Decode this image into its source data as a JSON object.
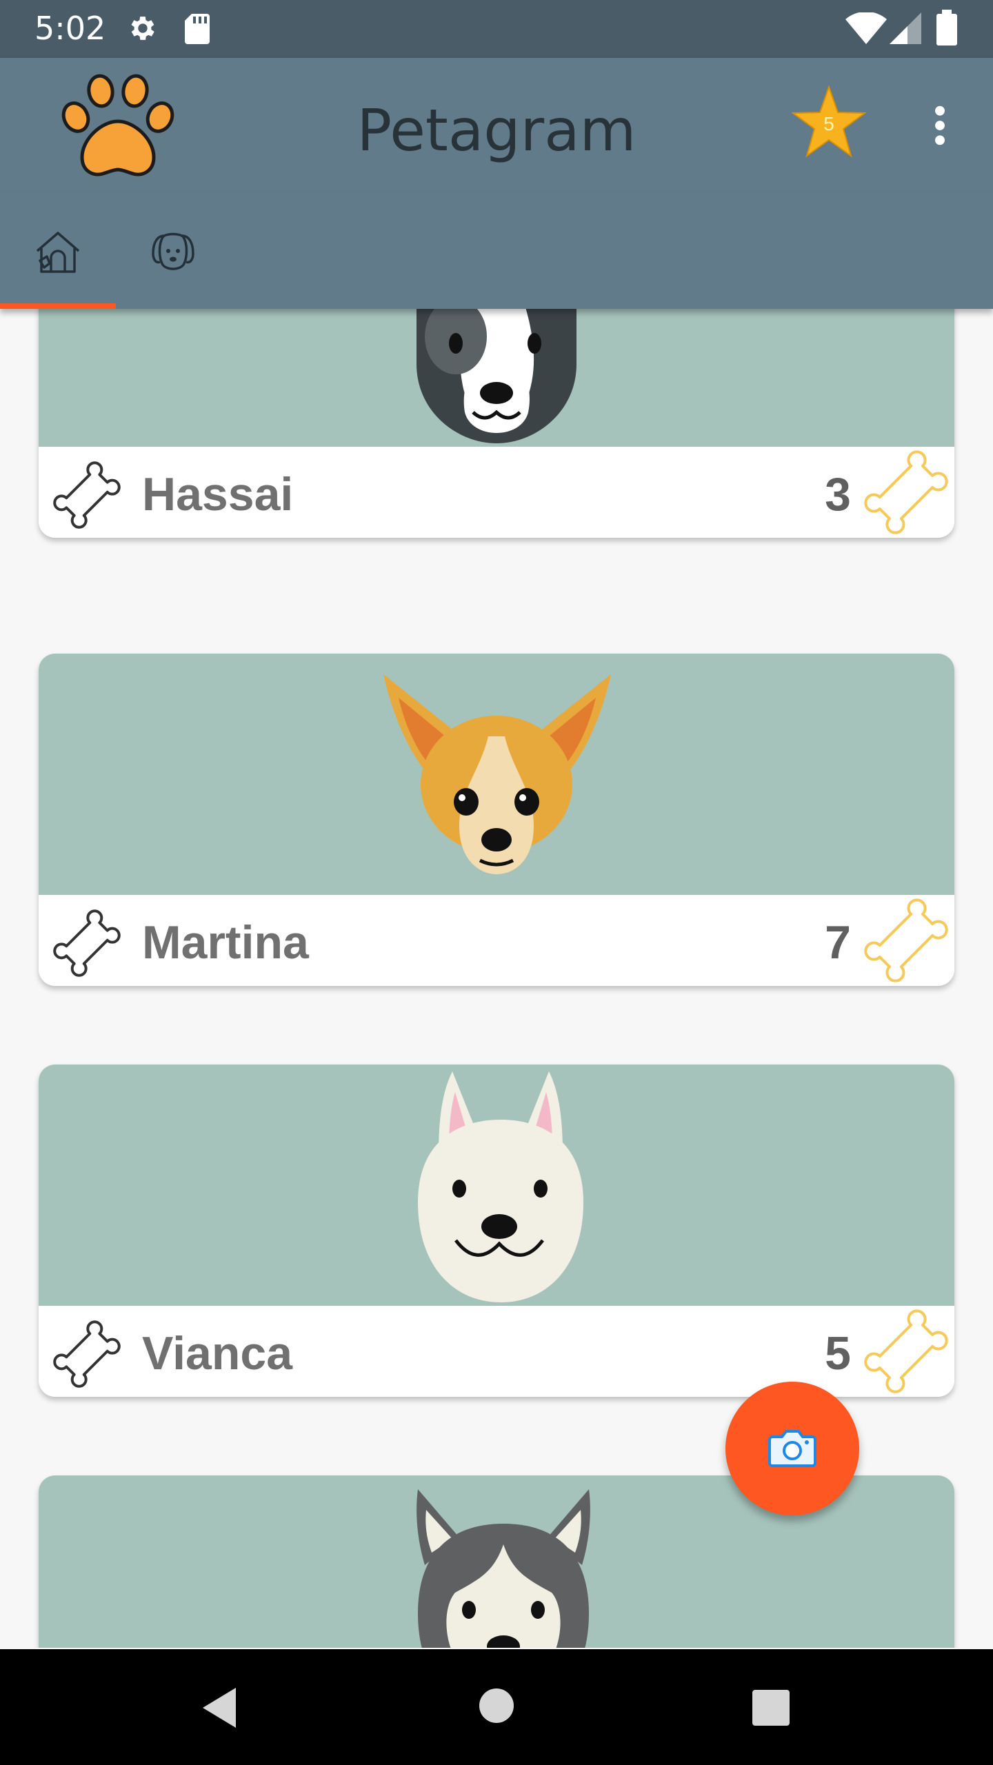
{
  "status_bar": {
    "time": "5:02"
  },
  "app_bar": {
    "title": "Petagram",
    "favorites_badge": "5"
  },
  "tabs": [
    {
      "icon": "doghouse-icon",
      "selected": true
    },
    {
      "icon": "dog-face-icon",
      "selected": false
    }
  ],
  "pets": [
    {
      "name": "Hassai",
      "likes": "3"
    },
    {
      "name": "Martina",
      "likes": "7"
    },
    {
      "name": "Vianca",
      "likes": "5"
    }
  ],
  "colors": {
    "primary": "#617b8a",
    "primary_dark": "#4a5c68",
    "accent": "#ff5722",
    "card_photo_bg": "#a6c3bb",
    "bone_like": "#f5c95a"
  }
}
